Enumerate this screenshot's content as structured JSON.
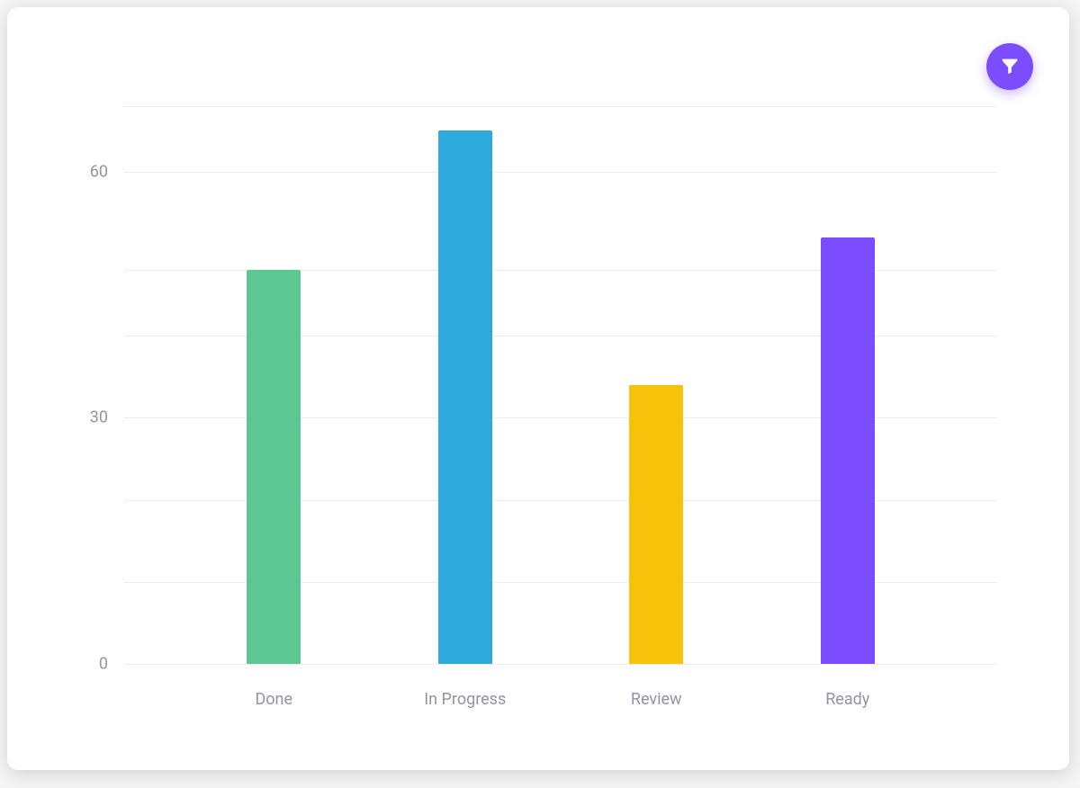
{
  "chart_data": {
    "type": "bar",
    "categories": [
      "Done",
      "In Progress",
      "Review",
      "Ready"
    ],
    "values": [
      48,
      65,
      34,
      52
    ],
    "title": "",
    "xlabel": "",
    "ylabel": "",
    "ylim": [
      0,
      68
    ],
    "y_ticks": [
      0,
      30,
      60
    ],
    "bar_colors": [
      "#5cc792",
      "#2eaadd",
      "#f7c20a",
      "#7c4dff"
    ]
  },
  "controls": {
    "filter_icon": "filter"
  }
}
